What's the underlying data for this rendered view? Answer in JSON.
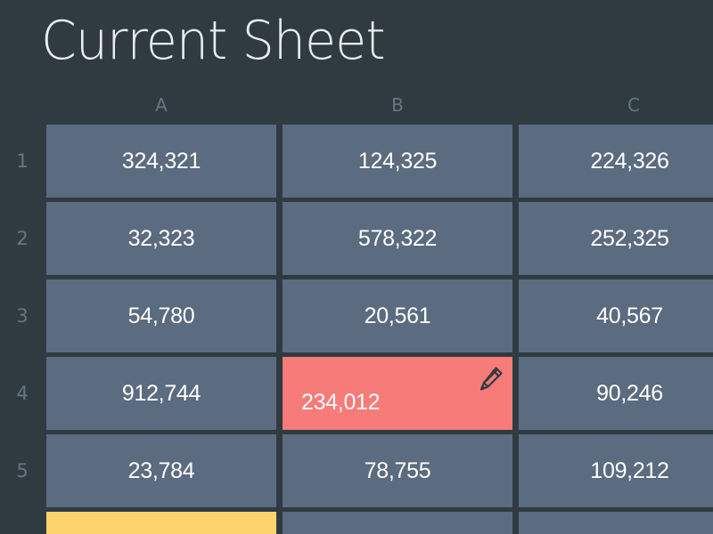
{
  "sheet": {
    "title": "Current Sheet",
    "columns": [
      "A",
      "B",
      "C"
    ],
    "rows": [
      {
        "label": "1",
        "cells": [
          "324,321",
          "124,325",
          "224,326"
        ]
      },
      {
        "label": "2",
        "cells": [
          "32,323",
          "578,322",
          "252,325"
        ]
      },
      {
        "label": "3",
        "cells": [
          "54,780",
          "20,561",
          "40,567"
        ]
      },
      {
        "label": "4",
        "cells": [
          "912,744",
          "234,012",
          "90,246"
        ]
      },
      {
        "label": "5",
        "cells": [
          "23,784",
          "78,755",
          "109,212"
        ]
      }
    ],
    "active_cell": "B4",
    "edit_icon": "pencil-icon"
  },
  "colors": {
    "background": "#2f3b41",
    "cell": "#5b6b80",
    "active_cell": "#f77b79",
    "highlight_cell": "#fbd56b",
    "header_text": "#66767f"
  }
}
